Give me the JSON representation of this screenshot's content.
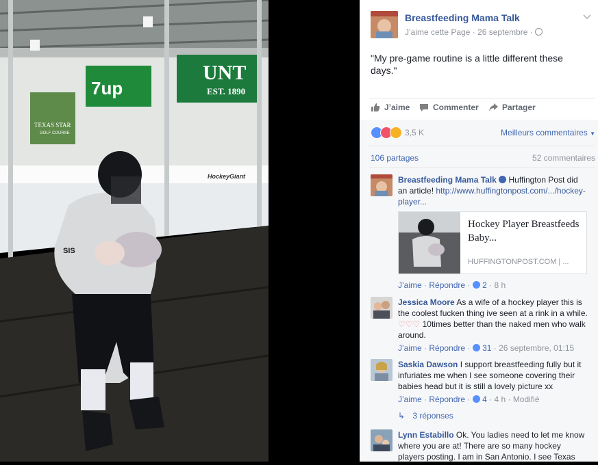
{
  "post": {
    "page_name": "Breastfeeding Mama Talk",
    "liked_page": "J’aime cette Page",
    "date": "26 septembre",
    "separator": "·",
    "text": "\"My pre-game routine is a little different these days.\""
  },
  "photo": {
    "sign_unt": "UNT",
    "sign_est": "EST. 1890",
    "sign_7up": "7up",
    "sign_texas_star": "TEXAS STAR",
    "sign_texas_star_sub": "GOLF COURSE",
    "board_hockey": "HockeyGiant",
    "player_number": "SIS"
  },
  "actions": {
    "like": "J’aime",
    "comment": "Commenter",
    "share": "Partager"
  },
  "reactions": {
    "count": "3,5 K",
    "sort": "Meilleurs commentaires",
    "shares": "106 partages",
    "comments": "52 commentaires"
  },
  "comments": [
    {
      "author": "Breastfeeding Mama Talk",
      "text": " Huffington Post did an article! ",
      "link": "http://www.huffingtonpost.com/.../hockey-player...",
      "preview_title": "Hockey Player Breastfeeds Baby...",
      "preview_domain": "HUFFINGTONPOST.COM | ...",
      "like": "J’aime",
      "reply": "Répondre",
      "likes": "2",
      "time": "8 h"
    },
    {
      "author": "Jessica Moore",
      "text": " As a wife of a hockey player this is the coolest fucken thing ive seen at a rink in a while.",
      "text2": " 10times better than the naked men who walk around.",
      "like": "J’aime",
      "reply": "Répondre",
      "likes": "31",
      "time": "26 septembre, 01:15"
    },
    {
      "author": "Saskia Dawson",
      "text": " I support breastfeeding fully but it infuriates me when I see someone covering their babies head but it is still a lovely picture xx",
      "like": "J’aime",
      "reply": "Répondre",
      "likes": "4",
      "time": "4 h",
      "edited": "Modifié",
      "replies": "3 réponses"
    },
    {
      "author": "Lynn Estabillo",
      "text": " Ok. You ladies need to let me know where you are at! There are so many hockey players posting. I am in San Antonio. I see Texas"
    }
  ],
  "colors": {
    "link_blue": "#365899",
    "action_blue": "#4267b2",
    "meta_grey": "#90949c",
    "like_blue": "#5890ff",
    "love_red": "#f25268"
  }
}
